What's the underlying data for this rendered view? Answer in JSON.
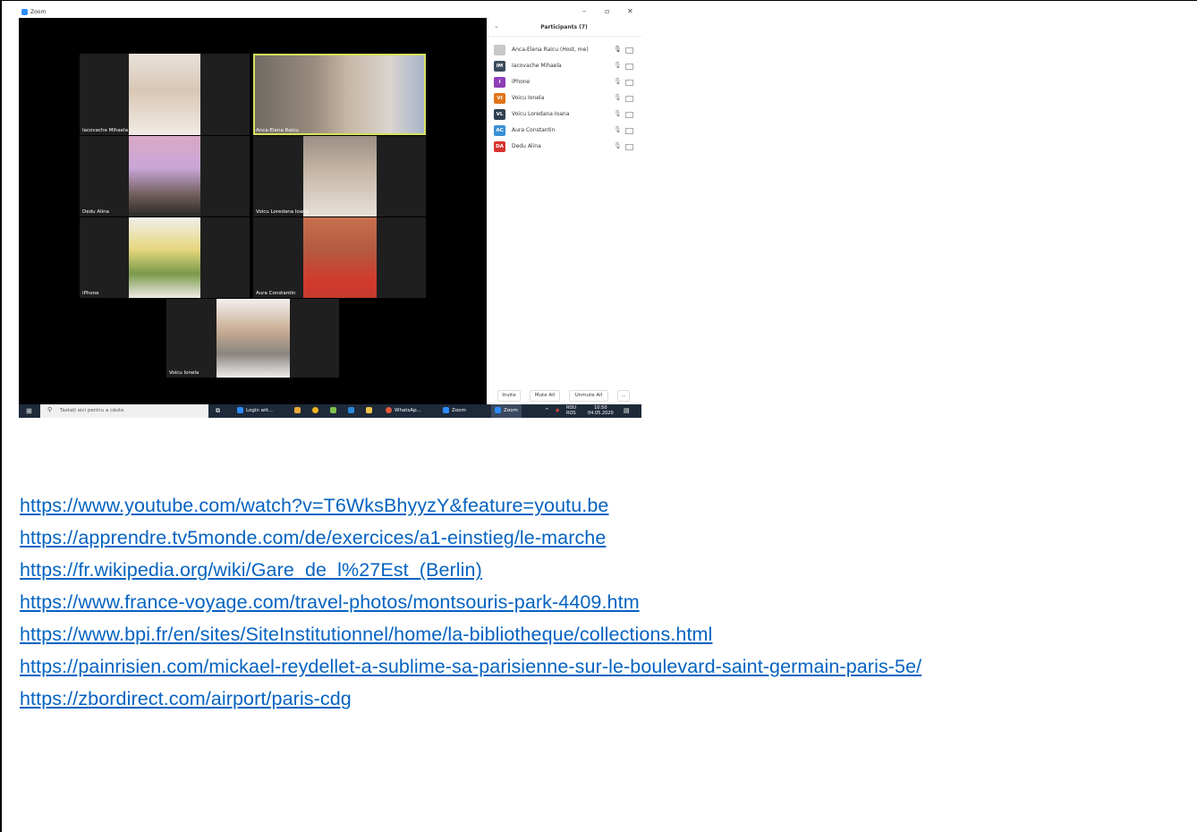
{
  "zoom": {
    "window_title": "Zoom",
    "window_controls": [
      "–",
      "▫",
      "✕"
    ],
    "tiles": [
      {
        "name": "Iacovache Mihaela",
        "active": false
      },
      {
        "name": "Anca-Elena Raicu",
        "active": true
      },
      {
        "name": "Dedu Alina",
        "active": false
      },
      {
        "name": "Voicu Loredana Ioana",
        "active": false
      },
      {
        "name": "iPhone",
        "active": false
      },
      {
        "name": "Aura Constantin",
        "active": false
      },
      {
        "name": "Voicu Ionela",
        "active": false
      }
    ],
    "participants_panel": {
      "title": "Participants (7)",
      "participants": [
        {
          "initials": "",
          "name": "Anca-Elena Raicu (Host, me)",
          "color": "#c8c8c8"
        },
        {
          "initials": "IM",
          "name": "Iacovache Mihaela",
          "color": "#3b4b5c"
        },
        {
          "initials": "I",
          "name": "iPhone",
          "color": "#8e3fb8"
        },
        {
          "initials": "VI",
          "name": "Voicu Ionela",
          "color": "#e0741a"
        },
        {
          "initials": "VL",
          "name": "Voicu Loredana Ioana",
          "color": "#2f3f4f"
        },
        {
          "initials": "AC",
          "name": "Aura Constantin",
          "color": "#3a8fd6"
        },
        {
          "initials": "DA",
          "name": "Dedu Alina",
          "color": "#d7332e"
        }
      ],
      "buttons": {
        "invite": "Invite",
        "mute_all": "Mute All",
        "unmute_all": "Unmute All",
        "more": "..."
      }
    },
    "taskbar": {
      "search_placeholder": "Tastați aici pentru a căuta",
      "items": [
        "Login wit...",
        "WhatsAp...",
        "Zoom",
        "Zoom"
      ],
      "lang_1": "ROU",
      "lang_2": "ROS",
      "time": "10:50",
      "date": "04.05.2020"
    }
  },
  "links": [
    "https://www.youtube.com/watch?v=T6WksBhyyzY&feature=youtu.be",
    "https://apprendre.tv5monde.com/de/exercices/a1-einstieg/le-marche",
    "https://fr.wikipedia.org/wiki/Gare_de_l%27Est_(Berlin)",
    "https://www.france-voyage.com/travel-photos/montsouris-park-4409.htm",
    "https://www.bpi.fr/en/sites/SiteInstitutionnel/home/la-bibliotheque/collections.html",
    "https://painrisien.com/mickael-reydellet-a-sublime-sa-parisienne-sur-le-boulevard-saint-germain-paris-5e/",
    "https://zbordirect.com/airport/paris-cdg"
  ],
  "colors": {
    "link": "#0563c1",
    "zoom_blue": "#2d8cff",
    "active_speaker": "#d6e25b"
  }
}
